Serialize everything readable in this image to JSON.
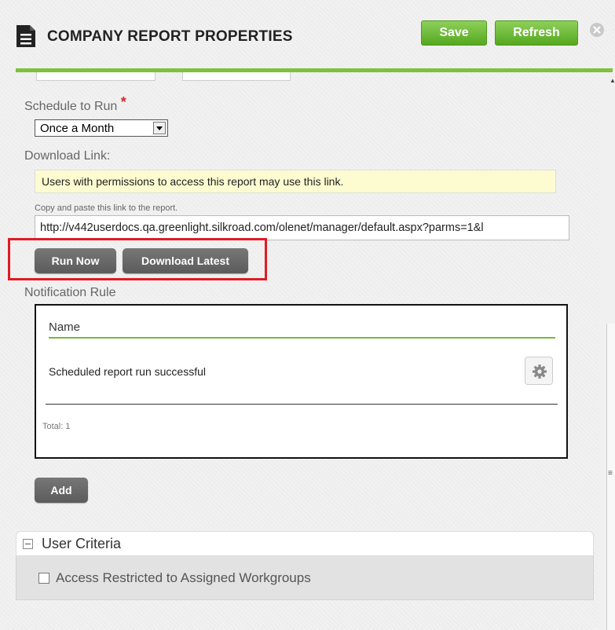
{
  "header": {
    "title": "COMPANY REPORT PROPERTIES",
    "save_label": "Save",
    "refresh_label": "Refresh",
    "title_icon": "document-icon",
    "close_icon": "close-icon"
  },
  "schedule": {
    "label": "Schedule to Run",
    "required_marker": "*",
    "selected": "Once a Month"
  },
  "download_link": {
    "label": "Download Link:",
    "info": "Users with permissions to access this report may use this link.",
    "hint": "Copy and paste this link to the report.",
    "url": "http://v442userdocs.qa.greenlight.silkroad.com/olenet/manager/default.aspx?parms=1&l"
  },
  "actions": {
    "run_now": "Run Now",
    "download_latest": "Download Latest"
  },
  "notification": {
    "label": "Notification Rule",
    "column_name": "Name",
    "rows": [
      {
        "name": "Scheduled report run successful"
      }
    ],
    "total": "Total: 1",
    "add_label": "Add"
  },
  "user_criteria": {
    "title": "User Criteria",
    "checkbox_label": "Access Restricted to Assigned Workgroups",
    "checked": false
  },
  "colors": {
    "accent_green": "#7ec13c",
    "highlight_red": "#e01b24",
    "dark_button": "#5b5b5b",
    "info_background": "#fdfbd0"
  }
}
